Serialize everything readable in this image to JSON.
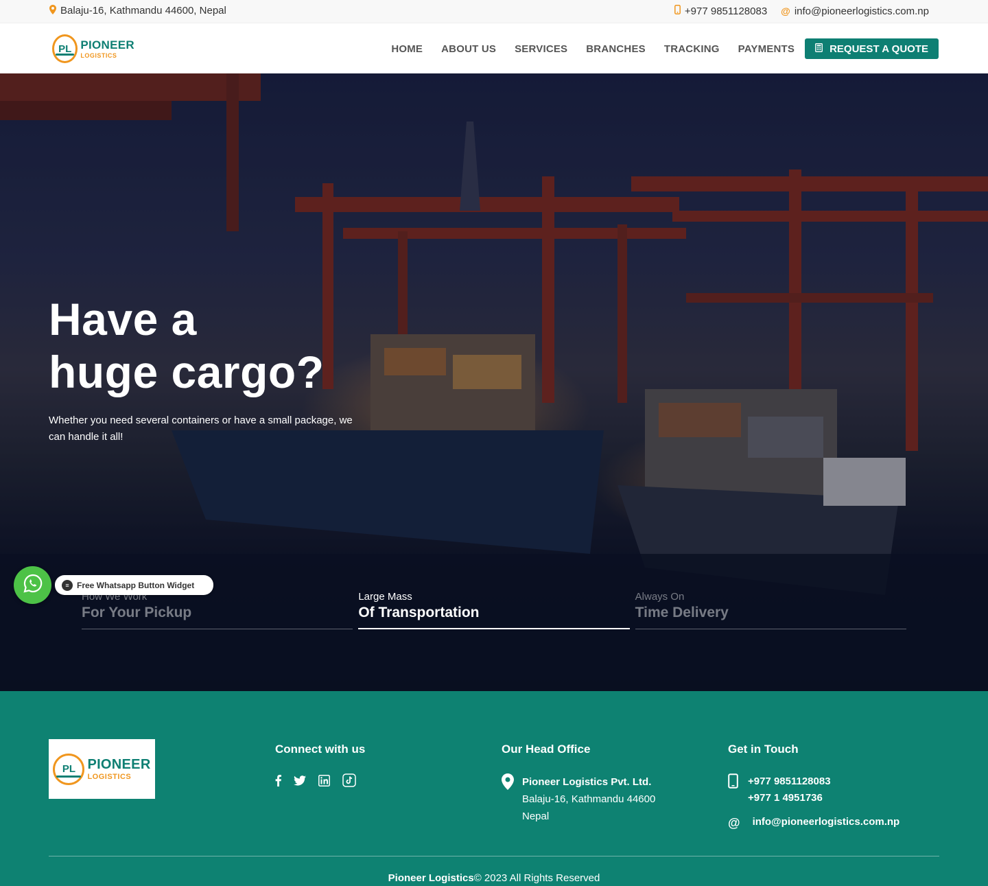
{
  "topbar": {
    "address": "Balaju-16, Kathmandu 44600, Nepal",
    "phone": "+977 9851128083",
    "email": "info@pioneerlogistics.com.np"
  },
  "brand": {
    "name": "PIONEER",
    "sub": "LOGISTICS",
    "mark": "PL"
  },
  "nav": {
    "items": [
      "HOME",
      "ABOUT US",
      "SERVICES",
      "BRANCHES",
      "TRACKING",
      "PAYMENTS"
    ],
    "quote": "REQUEST A QUOTE"
  },
  "hero": {
    "title_line1": "Have a",
    "title_line2": "huge cargo?",
    "subtitle": "Whether you need several containers or have a small package, we can handle it all!",
    "tabs": [
      {
        "small": "How We Work",
        "big": "For Your Pickup"
      },
      {
        "small": "Large Mass",
        "big": "Of Transportation"
      },
      {
        "small": "Always On",
        "big": "Time Delivery"
      }
    ]
  },
  "whatsapp": {
    "label": "Free Whatsapp Button Widget"
  },
  "footer": {
    "connect_title": "Connect with us",
    "office_title": "Our Head Office",
    "office_name": "Pioneer Logistics Pvt. Ltd.",
    "office_addr1": "Balaju-16, Kathmandu 44600",
    "office_addr2": "Nepal",
    "touch_title": "Get in Touch",
    "phone1": "+977 9851128083",
    "phone2": "+977 1 4951736",
    "email": "info@pioneerlogistics.com.np",
    "copyright_brand": "Pioneer Logistics",
    "copyright_text": "© 2023 All Rights Reserved"
  },
  "colors": {
    "brand_teal": "#0e7f73",
    "brand_orange": "#f0961e",
    "whatsapp_green": "#4dc247"
  }
}
